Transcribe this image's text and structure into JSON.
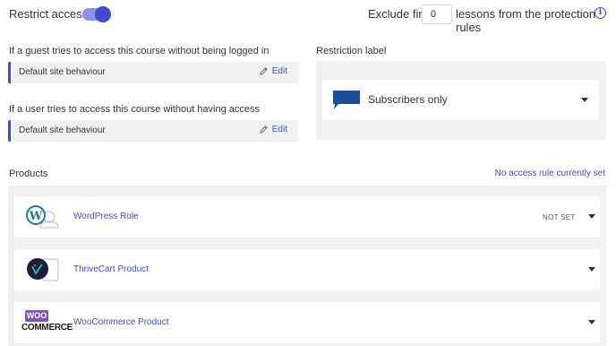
{
  "restrict": {
    "label": "Restrict access",
    "enabled": true
  },
  "exclude": {
    "prefix": "Exclude first",
    "value": "0",
    "suffix": "lessons from the protection rules",
    "info_icon": "info-circle-icon"
  },
  "guest": {
    "question": "If a guest tries to access this course without being logged in",
    "behaviour": "Default site behaviour",
    "edit_label": "Edit"
  },
  "user": {
    "question": "If a user tries to access this course without having access",
    "behaviour": "Default site behaviour",
    "edit_label": "Edit"
  },
  "restriction": {
    "title": "Restriction label",
    "selected": "Subscribers only",
    "icon": "speech-bubble-icon"
  },
  "products": {
    "title": "Products",
    "status": "No access rule currently set",
    "items": [
      {
        "name": "WordPress Role",
        "badge": "NOT SET",
        "logo": "wordpress-logo"
      },
      {
        "name": "ThriveCart Product",
        "badge": "",
        "logo": "thrivecart-logo"
      },
      {
        "name": "WooCommerce Product",
        "badge": "",
        "logo": "woocommerce-logo",
        "logo_text_top": "WOO",
        "logo_text_bottom": "COMMERCE"
      }
    ]
  },
  "colors": {
    "accent": "#3c4bd0",
    "toggle_track": "#8b93e6",
    "panel_bg": "#f0f1f3",
    "label_icon": "#1a4f9c",
    "woo_purple": "#7f54b3"
  }
}
